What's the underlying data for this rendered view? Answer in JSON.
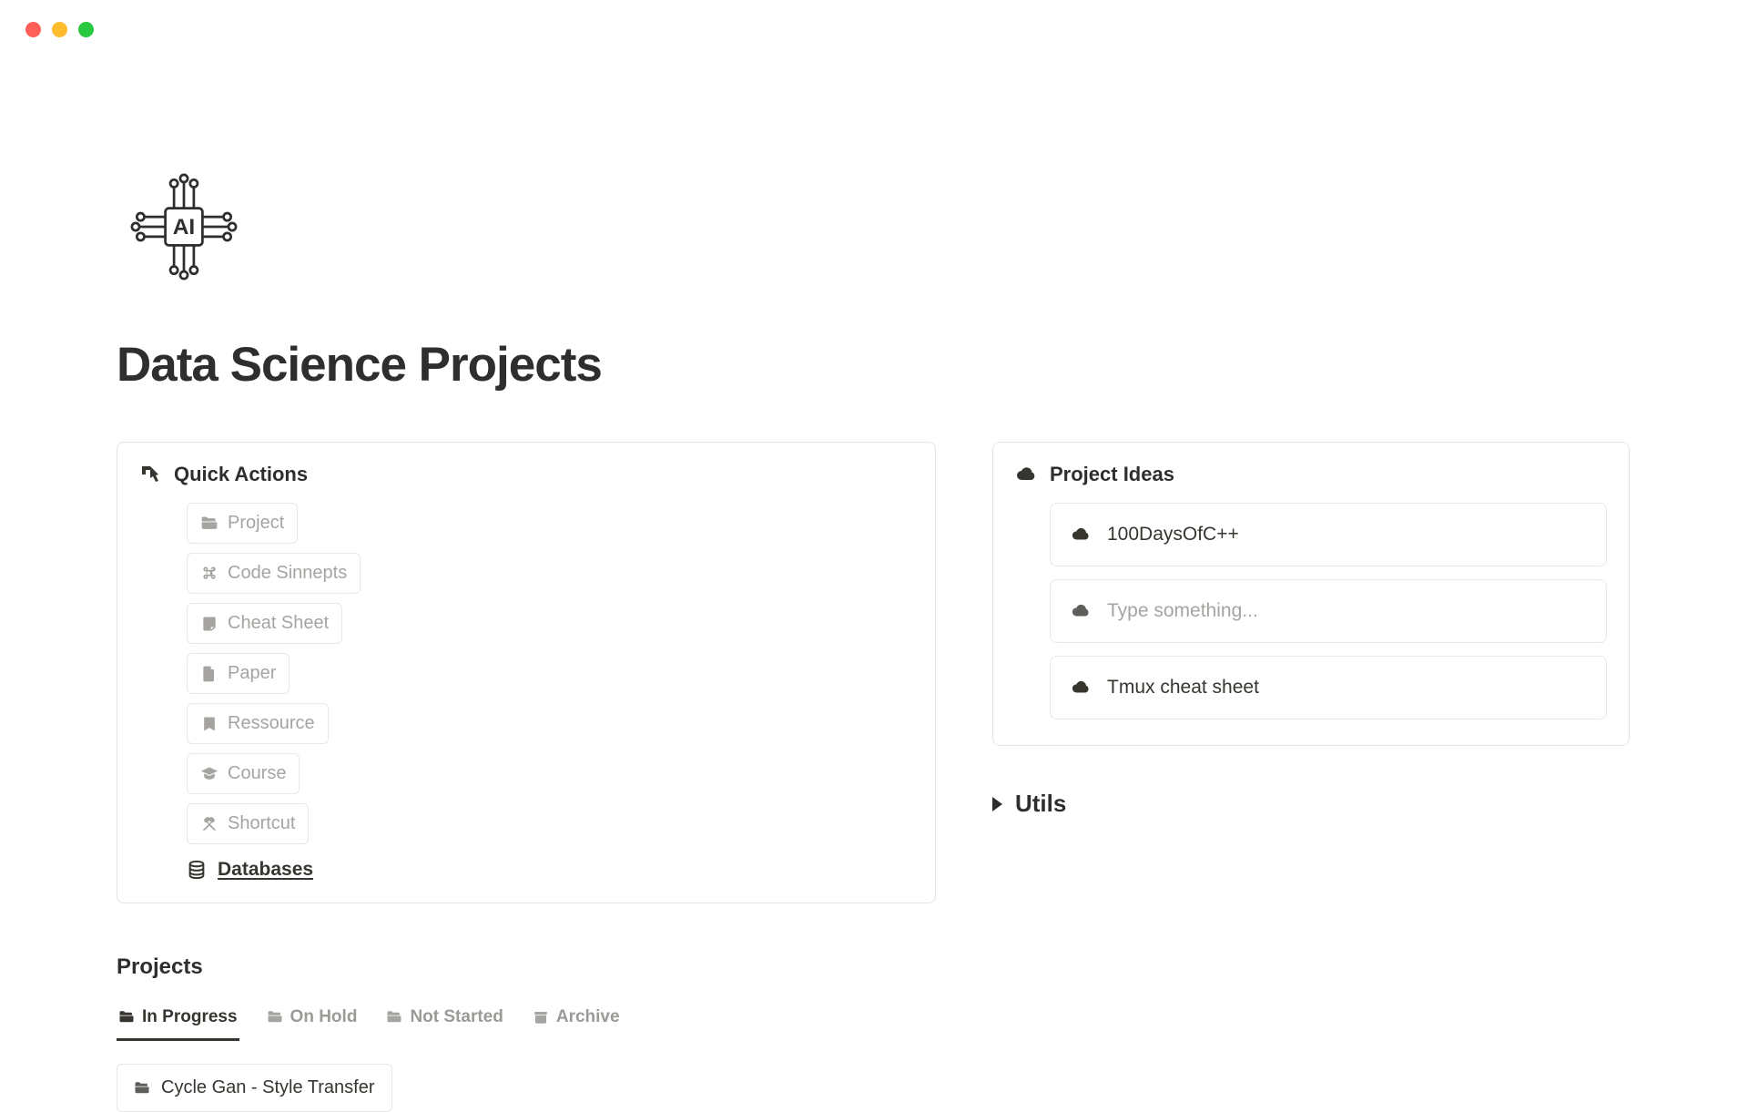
{
  "page_title": "Data Science Projects",
  "quick_actions": {
    "title": "Quick Actions",
    "items": [
      {
        "label": "Project",
        "icon": "folder"
      },
      {
        "label": "Code Sinnepts",
        "icon": "command"
      },
      {
        "label": "Cheat Sheet",
        "icon": "note"
      },
      {
        "label": "Paper",
        "icon": "page"
      },
      {
        "label": "Ressource",
        "icon": "bookmark"
      },
      {
        "label": "Course",
        "icon": "graduation"
      },
      {
        "label": "Shortcut",
        "icon": "scissors"
      }
    ],
    "databases_label": "Databases"
  },
  "project_ideas": {
    "title": "Project Ideas",
    "items": [
      {
        "label": "100DaysOfC++",
        "placeholder": false
      },
      {
        "label": "Type something...",
        "placeholder": true
      },
      {
        "label": "Tmux cheat sheet",
        "placeholder": false
      }
    ]
  },
  "utils": {
    "title": "Utils"
  },
  "projects": {
    "title": "Projects",
    "tabs": [
      {
        "label": "In Progress",
        "active": true,
        "icon": "folder"
      },
      {
        "label": "On Hold",
        "active": false,
        "icon": "folder"
      },
      {
        "label": "Not Started",
        "active": false,
        "icon": "folder"
      },
      {
        "label": "Archive",
        "active": false,
        "icon": "archive"
      }
    ],
    "rows": [
      {
        "label": "Cycle Gan - Style Transfer"
      }
    ]
  }
}
